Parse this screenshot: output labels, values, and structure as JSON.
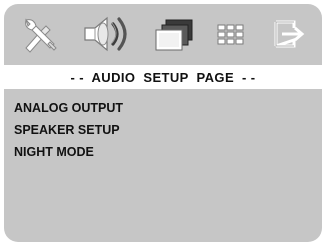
{
  "page": {
    "title": "- -  AUDIO  SETUP  PAGE  - -"
  },
  "icons": [
    {
      "name": "tools-icon",
      "label": "General setup"
    },
    {
      "name": "speaker-icon",
      "label": "Audio setup",
      "selected": true
    },
    {
      "name": "video-icon",
      "label": "Video setup"
    },
    {
      "name": "preferences-grid-icon",
      "label": "Preferences"
    },
    {
      "name": "exit-icon",
      "label": "Exit"
    }
  ],
  "menu": {
    "items": [
      {
        "label": "ANALOG OUTPUT"
      },
      {
        "label": "SPEAKER SETUP"
      },
      {
        "label": "NIGHT MODE"
      }
    ]
  },
  "colors": {
    "background": "#c6c6c6",
    "title_bar": "#ffffff",
    "text": "#111111",
    "icon_light": "#ffffff",
    "icon_dark": "#4a4a4a"
  }
}
